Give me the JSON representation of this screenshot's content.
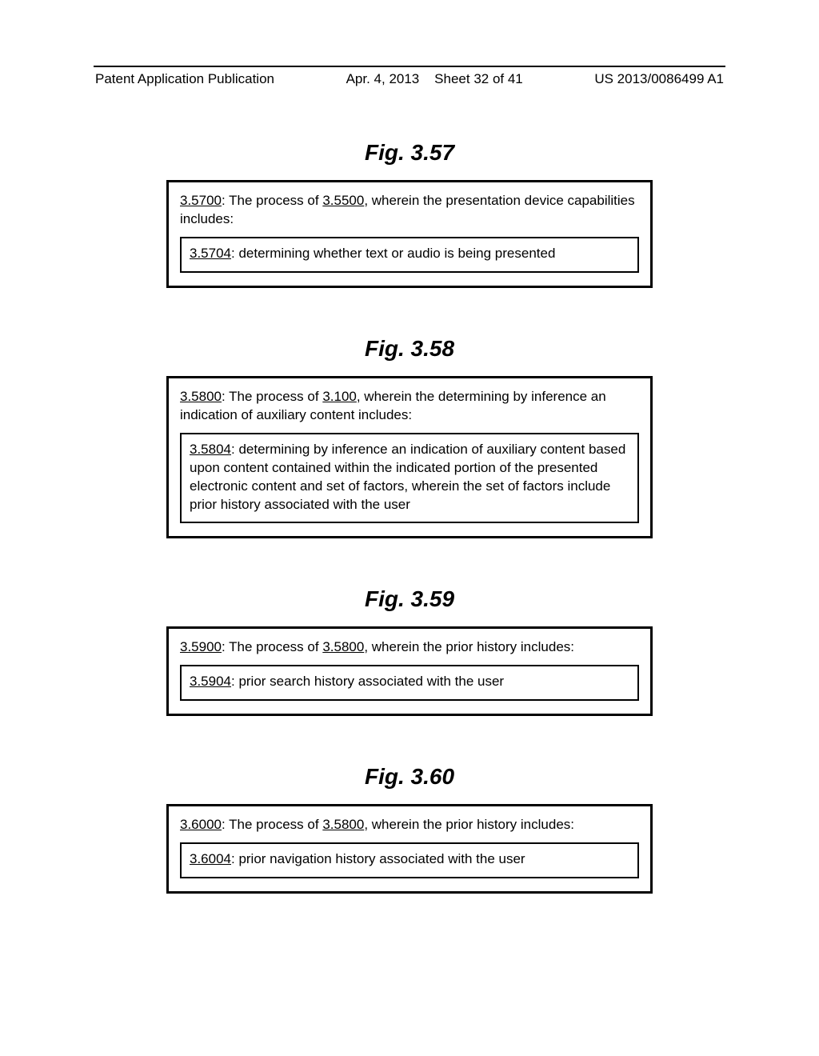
{
  "header": {
    "pub_label": "Patent Application Publication",
    "date": "Apr. 4, 2013",
    "sheet": "Sheet 32 of 41",
    "pub_no": "US 2013/0086499 A1"
  },
  "figures": [
    {
      "title": "Fig. 3.57",
      "outer_ref": "3.5700",
      "outer_text_1": ": The process of ",
      "outer_ref2": "3.5500",
      "outer_text_2": ", wherein the presentation device capabilities includes:",
      "inner_ref": "3.5704",
      "inner_text": ": determining whether text or audio is being presented"
    },
    {
      "title": "Fig. 3.58",
      "outer_ref": "3.5800",
      "outer_text_1": ": The process of ",
      "outer_ref2": "3.100",
      "outer_text_2": ", wherein the determining by inference an indication of auxiliary content includes:",
      "inner_ref": "3.5804",
      "inner_text": ": determining by inference an indication of auxiliary content based upon content contained within the indicated portion of the presented electronic content and set of factors, wherein the set of factors include prior history associated with the user"
    },
    {
      "title": "Fig. 3.59",
      "outer_ref": "3.5900",
      "outer_text_1": ": The process of ",
      "outer_ref2": "3.5800",
      "outer_text_2": ", wherein the prior history includes:",
      "inner_ref": "3.5904",
      "inner_text": ": prior search history associated with the user"
    },
    {
      "title": "Fig. 3.60",
      "outer_ref": "3.6000",
      "outer_text_1": ": The process of ",
      "outer_ref2": "3.5800",
      "outer_text_2": ", wherein the prior history includes:",
      "inner_ref": "3.6004",
      "inner_text": ": prior navigation history associated with the user"
    }
  ]
}
